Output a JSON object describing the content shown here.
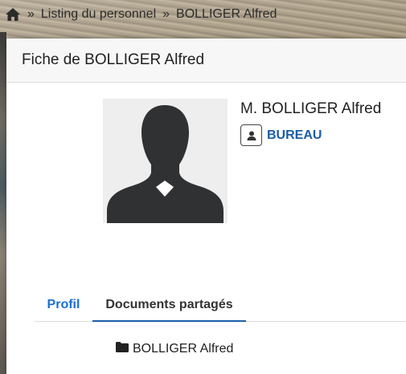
{
  "breadcrumb": {
    "home_icon": "home-icon",
    "separator": "»",
    "items": [
      "Listing du personnel",
      "BOLLIGER Alfred"
    ]
  },
  "card": {
    "title": "Fiche de BOLLIGER Alfred"
  },
  "profile": {
    "name": "M. BOLLIGER Alfred",
    "badge_icon": "user-badge-icon",
    "bureau_label": "BUREAU",
    "avatar_icon": "person-silhouette-icon"
  },
  "tabs": [
    {
      "label": "Profil",
      "active": false
    },
    {
      "label": "Documents partagés",
      "active": true
    }
  ],
  "documents": {
    "folder_icon": "folder-icon",
    "items": [
      "BOLLIGER Alfred"
    ]
  },
  "colors": {
    "link": "#1a5ea8",
    "tab_profil": "#1a6fd0",
    "avatar": "#2f3133"
  }
}
